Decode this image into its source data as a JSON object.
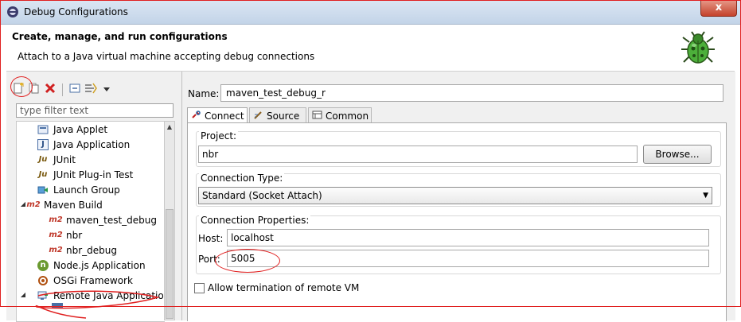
{
  "window": {
    "title": "Debug Configurations",
    "close_glyph": "x"
  },
  "header": {
    "title": "Create, manage, and run configurations",
    "description": "Attach to a Java virtual machine accepting debug connections",
    "icon": "debug-bug-icon"
  },
  "toolbar": {
    "buttons": [
      {
        "icon": "new-launch-configuration-icon"
      },
      {
        "icon": "duplicate-icon"
      },
      {
        "icon": "delete-icon"
      },
      {
        "icon": "collapse-all-icon"
      },
      {
        "icon": "filter-icon"
      },
      {
        "icon": "view-menu-icon"
      }
    ]
  },
  "filter": {
    "placeholder": "type filter text"
  },
  "tree": {
    "items": [
      {
        "label": "Java Applet",
        "icon": "java-applet-icon",
        "badge": ""
      },
      {
        "label": "Java Application",
        "icon": "java-application-icon",
        "badge": "J"
      },
      {
        "label": "JUnit",
        "icon": "junit-icon",
        "badge": "Ju"
      },
      {
        "label": "JUnit Plug-in Test",
        "icon": "junit-plugin-icon",
        "badge": "Ju"
      },
      {
        "label": "Launch Group",
        "icon": "launch-group-icon",
        "badge": ""
      },
      {
        "label": "Maven Build",
        "icon": "maven-icon",
        "badge": "m2"
      },
      {
        "label": "maven_test_debug",
        "icon": "maven-icon",
        "badge": "m2"
      },
      {
        "label": "nbr",
        "icon": "maven-icon",
        "badge": "m2"
      },
      {
        "label": "nbr_debug",
        "icon": "maven-icon",
        "badge": "m2"
      },
      {
        "label": "Node.js Application",
        "icon": "nodejs-icon",
        "badge": "n"
      },
      {
        "label": "OSGi Framework",
        "icon": "osgi-icon",
        "badge": ""
      },
      {
        "label": "Remote Java Application",
        "icon": "remote-java-icon",
        "badge": ""
      }
    ]
  },
  "config": {
    "name_label": "Name:",
    "name_value": "maven_test_debug_r",
    "tabs": [
      {
        "label": "Connect",
        "icon": "connect-icon"
      },
      {
        "label": "Source",
        "icon": "source-icon"
      },
      {
        "label": "Common",
        "icon": "common-icon"
      }
    ],
    "project": {
      "group_label": "Project:",
      "value": "nbr",
      "browse_label": "Browse..."
    },
    "connection_type": {
      "group_label": "Connection Type:",
      "selected": "Standard (Socket Attach)"
    },
    "connection_properties": {
      "group_label": "Connection Properties:",
      "host_label": "Host:",
      "host_value": "localhost",
      "port_label": "Port:",
      "port_value": "5005"
    },
    "allow_termination": {
      "label": "Allow termination of remote VM",
      "checked": false
    }
  },
  "colors": {
    "annotation": "#e02020",
    "titlebar": "#c3d4e8",
    "close": "#c4422b",
    "maven": "#c0392b"
  }
}
